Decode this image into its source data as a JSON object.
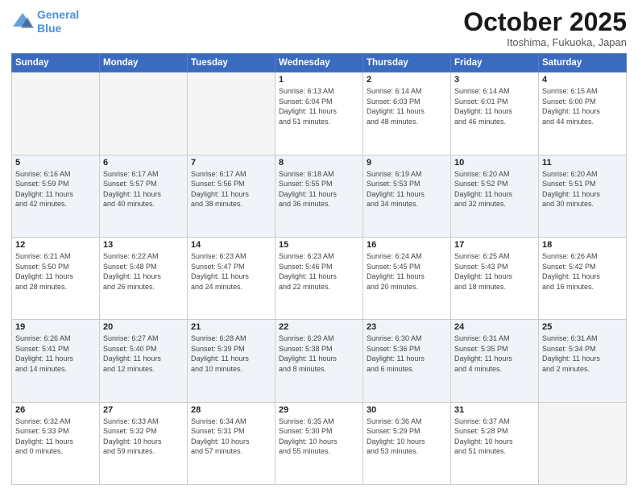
{
  "logo": {
    "line1": "General",
    "line2": "Blue"
  },
  "header": {
    "month": "October 2025",
    "location": "Itoshima, Fukuoka, Japan"
  },
  "weekdays": [
    "Sunday",
    "Monday",
    "Tuesday",
    "Wednesday",
    "Thursday",
    "Friday",
    "Saturday"
  ],
  "weeks": [
    [
      {
        "day": "",
        "info": ""
      },
      {
        "day": "",
        "info": ""
      },
      {
        "day": "",
        "info": ""
      },
      {
        "day": "1",
        "info": "Sunrise: 6:13 AM\nSunset: 6:04 PM\nDaylight: 11 hours\nand 51 minutes."
      },
      {
        "day": "2",
        "info": "Sunrise: 6:14 AM\nSunset: 6:03 PM\nDaylight: 11 hours\nand 48 minutes."
      },
      {
        "day": "3",
        "info": "Sunrise: 6:14 AM\nSunset: 6:01 PM\nDaylight: 11 hours\nand 46 minutes."
      },
      {
        "day": "4",
        "info": "Sunrise: 6:15 AM\nSunset: 6:00 PM\nDaylight: 11 hours\nand 44 minutes."
      }
    ],
    [
      {
        "day": "5",
        "info": "Sunrise: 6:16 AM\nSunset: 5:59 PM\nDaylight: 11 hours\nand 42 minutes."
      },
      {
        "day": "6",
        "info": "Sunrise: 6:17 AM\nSunset: 5:57 PM\nDaylight: 11 hours\nand 40 minutes."
      },
      {
        "day": "7",
        "info": "Sunrise: 6:17 AM\nSunset: 5:56 PM\nDaylight: 11 hours\nand 38 minutes."
      },
      {
        "day": "8",
        "info": "Sunrise: 6:18 AM\nSunset: 5:55 PM\nDaylight: 11 hours\nand 36 minutes."
      },
      {
        "day": "9",
        "info": "Sunrise: 6:19 AM\nSunset: 5:53 PM\nDaylight: 11 hours\nand 34 minutes."
      },
      {
        "day": "10",
        "info": "Sunrise: 6:20 AM\nSunset: 5:52 PM\nDaylight: 11 hours\nand 32 minutes."
      },
      {
        "day": "11",
        "info": "Sunrise: 6:20 AM\nSunset: 5:51 PM\nDaylight: 11 hours\nand 30 minutes."
      }
    ],
    [
      {
        "day": "12",
        "info": "Sunrise: 6:21 AM\nSunset: 5:50 PM\nDaylight: 11 hours\nand 28 minutes."
      },
      {
        "day": "13",
        "info": "Sunrise: 6:22 AM\nSunset: 5:48 PM\nDaylight: 11 hours\nand 26 minutes."
      },
      {
        "day": "14",
        "info": "Sunrise: 6:23 AM\nSunset: 5:47 PM\nDaylight: 11 hours\nand 24 minutes."
      },
      {
        "day": "15",
        "info": "Sunrise: 6:23 AM\nSunset: 5:46 PM\nDaylight: 11 hours\nand 22 minutes."
      },
      {
        "day": "16",
        "info": "Sunrise: 6:24 AM\nSunset: 5:45 PM\nDaylight: 11 hours\nand 20 minutes."
      },
      {
        "day": "17",
        "info": "Sunrise: 6:25 AM\nSunset: 5:43 PM\nDaylight: 11 hours\nand 18 minutes."
      },
      {
        "day": "18",
        "info": "Sunrise: 6:26 AM\nSunset: 5:42 PM\nDaylight: 11 hours\nand 16 minutes."
      }
    ],
    [
      {
        "day": "19",
        "info": "Sunrise: 6:26 AM\nSunset: 5:41 PM\nDaylight: 11 hours\nand 14 minutes."
      },
      {
        "day": "20",
        "info": "Sunrise: 6:27 AM\nSunset: 5:40 PM\nDaylight: 11 hours\nand 12 minutes."
      },
      {
        "day": "21",
        "info": "Sunrise: 6:28 AM\nSunset: 5:39 PM\nDaylight: 11 hours\nand 10 minutes."
      },
      {
        "day": "22",
        "info": "Sunrise: 6:29 AM\nSunset: 5:38 PM\nDaylight: 11 hours\nand 8 minutes."
      },
      {
        "day": "23",
        "info": "Sunrise: 6:30 AM\nSunset: 5:36 PM\nDaylight: 11 hours\nand 6 minutes."
      },
      {
        "day": "24",
        "info": "Sunrise: 6:31 AM\nSunset: 5:35 PM\nDaylight: 11 hours\nand 4 minutes."
      },
      {
        "day": "25",
        "info": "Sunrise: 6:31 AM\nSunset: 5:34 PM\nDaylight: 11 hours\nand 2 minutes."
      }
    ],
    [
      {
        "day": "26",
        "info": "Sunrise: 6:32 AM\nSunset: 5:33 PM\nDaylight: 11 hours\nand 0 minutes."
      },
      {
        "day": "27",
        "info": "Sunrise: 6:33 AM\nSunset: 5:32 PM\nDaylight: 10 hours\nand 59 minutes."
      },
      {
        "day": "28",
        "info": "Sunrise: 6:34 AM\nSunset: 5:31 PM\nDaylight: 10 hours\nand 57 minutes."
      },
      {
        "day": "29",
        "info": "Sunrise: 6:35 AM\nSunset: 5:30 PM\nDaylight: 10 hours\nand 55 minutes."
      },
      {
        "day": "30",
        "info": "Sunrise: 6:36 AM\nSunset: 5:29 PM\nDaylight: 10 hours\nand 53 minutes."
      },
      {
        "day": "31",
        "info": "Sunrise: 6:37 AM\nSunset: 5:28 PM\nDaylight: 10 hours\nand 51 minutes."
      },
      {
        "day": "",
        "info": ""
      }
    ]
  ]
}
